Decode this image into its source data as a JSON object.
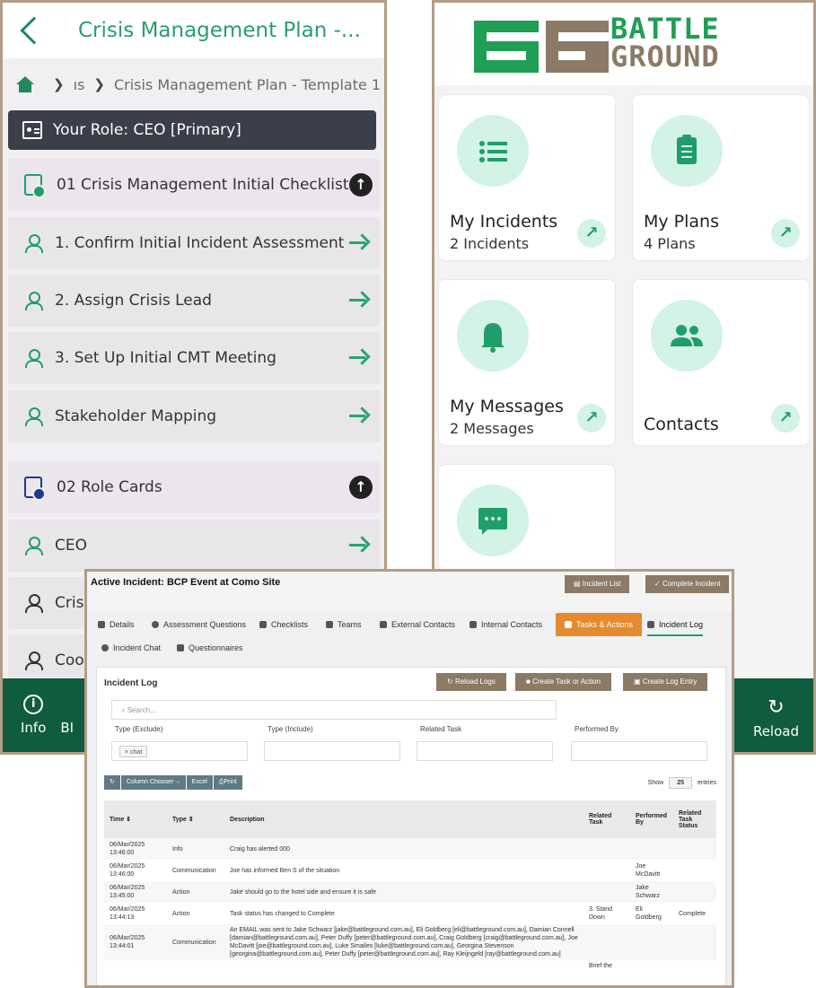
{
  "mobile_plan": {
    "title": "Crisis Management Plan -...",
    "breadcrumb": {
      "part": "ıs",
      "current": "Crisis Management Plan - Template 1"
    },
    "role_label": "Your Role:  CEO [Primary]",
    "sections": [
      {
        "label": "01 Crisis Management  Initial Checklist",
        "items": [
          "1. Confirm Initial Incident Assessment",
          "2. Assign Crisis Lead",
          "3. Set Up Initial CMT Meeting",
          "Stakeholder Mapping"
        ]
      },
      {
        "label": "02 Role Cards",
        "items": [
          "CEO",
          "Crisi",
          "Coo"
        ]
      }
    ],
    "footer": {
      "info": "Info",
      "bi": "BI"
    }
  },
  "mobile_home": {
    "logo": {
      "line1": "BATTLE",
      "line2": "GROUND"
    },
    "cards": [
      {
        "title": "My Incidents",
        "sub": "2 Incidents",
        "icon": "list-icon"
      },
      {
        "title": "My Plans",
        "sub": "4 Plans",
        "icon": "clipboard-icon"
      },
      {
        "title": "My Messages",
        "sub": "2 Messages",
        "icon": "bell-icon"
      },
      {
        "title": "Contacts",
        "sub": "",
        "icon": "people-icon"
      },
      {
        "title": "",
        "sub": "",
        "icon": "chat-icon"
      }
    ],
    "footer": {
      "reload": "Reload"
    }
  },
  "incident": {
    "title": "Active Incident: BCP Event at Como Site",
    "buttons": {
      "list": "Incident List",
      "complete": "Complete Incident"
    },
    "tabs": [
      "Details",
      "Assessment Questions",
      "Checklists",
      "Teams",
      "External Contacts",
      "Internal Contacts",
      "Tasks & Actions",
      "Incident Log",
      "Incident Chat",
      "Questionnaires"
    ],
    "log": {
      "title": "Incident Log",
      "buttons": {
        "reload": "Reload Logs",
        "create_task": "Create Task or Action",
        "create_log": "Create Log Entry"
      },
      "search_placeholder": "Search...",
      "filters": [
        "Type (Exclude)",
        "Type (Include)",
        "Related Task",
        "Performed By"
      ],
      "chip": "× chat",
      "grid_buttons": [
        "Column Chooser ⌵",
        "Excel",
        "Print"
      ],
      "show": {
        "label": "Show",
        "value": "25",
        "suffix": "entries"
      },
      "columns": [
        "Time",
        "Type",
        "Description",
        "Related Task",
        "Performed By",
        "Related Task Status"
      ],
      "rows": [
        {
          "time": "06/Mar/2025 13:46:00",
          "type": "Info",
          "desc": "Craig has alerted 000",
          "task": "",
          "by": "",
          "status": ""
        },
        {
          "time": "06/Mar/2025 13:46:00",
          "type": "Communication",
          "desc": "Joe has informed Ben S of the situation",
          "task": "",
          "by": "Joe McDavitt",
          "status": ""
        },
        {
          "time": "06/Mar/2025 13:45:00",
          "type": "Action",
          "desc": "Jake should go to the hotel side and ensure it is safe",
          "task": "",
          "by": "Jake Schwarz",
          "status": ""
        },
        {
          "time": "06/Mar/2025 13:44:13",
          "type": "Action",
          "desc": "Task status has changed to Complete",
          "task": "3. Stand Down",
          "by": "Eli Goldberg",
          "status": "Complete"
        },
        {
          "time": "06/Mar/2025 13:44:01",
          "type": "Communication",
          "desc": "An EMAIL was sent to Jake Schwarz [jake@battleground.com.au], Eli Goldberg [eli@battleground.com.au], Damian Connell [damian@battleground.com.au], Peter Duffy [peter@battleground.com.au], Craig Goldberg [craig@battleground.com.au], Joe McDavitt [joe@battleground.com.au], Luke Smailes [luke@battleground.com.au], Georgina Stevenson [georgina@battleground.com.au], Peter Duffy [peter@battleground.com.au], Ray Kleijngeld [ray@battleground.com.au]",
          "task": "",
          "by": "",
          "status": ""
        },
        {
          "time": "",
          "type": "",
          "desc": "",
          "task": "Brief the",
          "by": "",
          "status": ""
        }
      ]
    }
  },
  "colors": {
    "accent": "#1f9e6a",
    "brown": "#8a7a66",
    "orange": "#e58a2e",
    "dark_green": "#0f5c3e"
  }
}
